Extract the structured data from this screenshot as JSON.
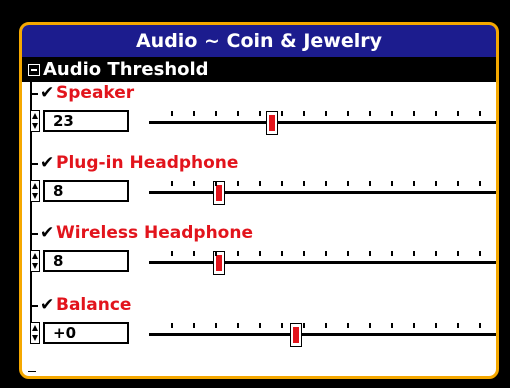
{
  "window": {
    "title": "Audio ~ Coin & Jewelry"
  },
  "section": {
    "title": "Audio Threshold",
    "expanded": true
  },
  "items": [
    {
      "label": "Speaker",
      "value": "23",
      "checked": true,
      "level": 23,
      "max": 60
    },
    {
      "label": "Plug-in Headphone",
      "value": "8",
      "checked": true,
      "level": 8,
      "max": 60
    },
    {
      "label": "Wireless Headphone",
      "value": "8",
      "checked": true,
      "level": 8,
      "max": 60
    },
    {
      "label": "Balance",
      "value": "+0",
      "checked": true,
      "level": 0,
      "min": -10,
      "max": 10
    }
  ],
  "colors": {
    "frame": "#f5a800",
    "titlebar": "#1c1c8e",
    "label": "#e2141c",
    "thumb": "#e2141c"
  }
}
